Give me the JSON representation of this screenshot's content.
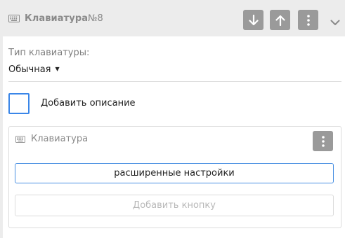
{
  "header": {
    "title": "Клавиатура",
    "number": "№8",
    "icon": "keyboard-icon"
  },
  "keyboard_type": {
    "label": "Тип клавиатуры:",
    "value": "Обычная"
  },
  "description_checkbox": {
    "label": "Добавить описание",
    "checked": false
  },
  "inner_card": {
    "title": "Клавиатура",
    "icon": "keyboard-icon",
    "advanced_button": "расширенные настройки",
    "add_button": "Добавить кнопку"
  },
  "colors": {
    "accent": "#3a86e8",
    "button_gray": "#9a9a9a"
  }
}
